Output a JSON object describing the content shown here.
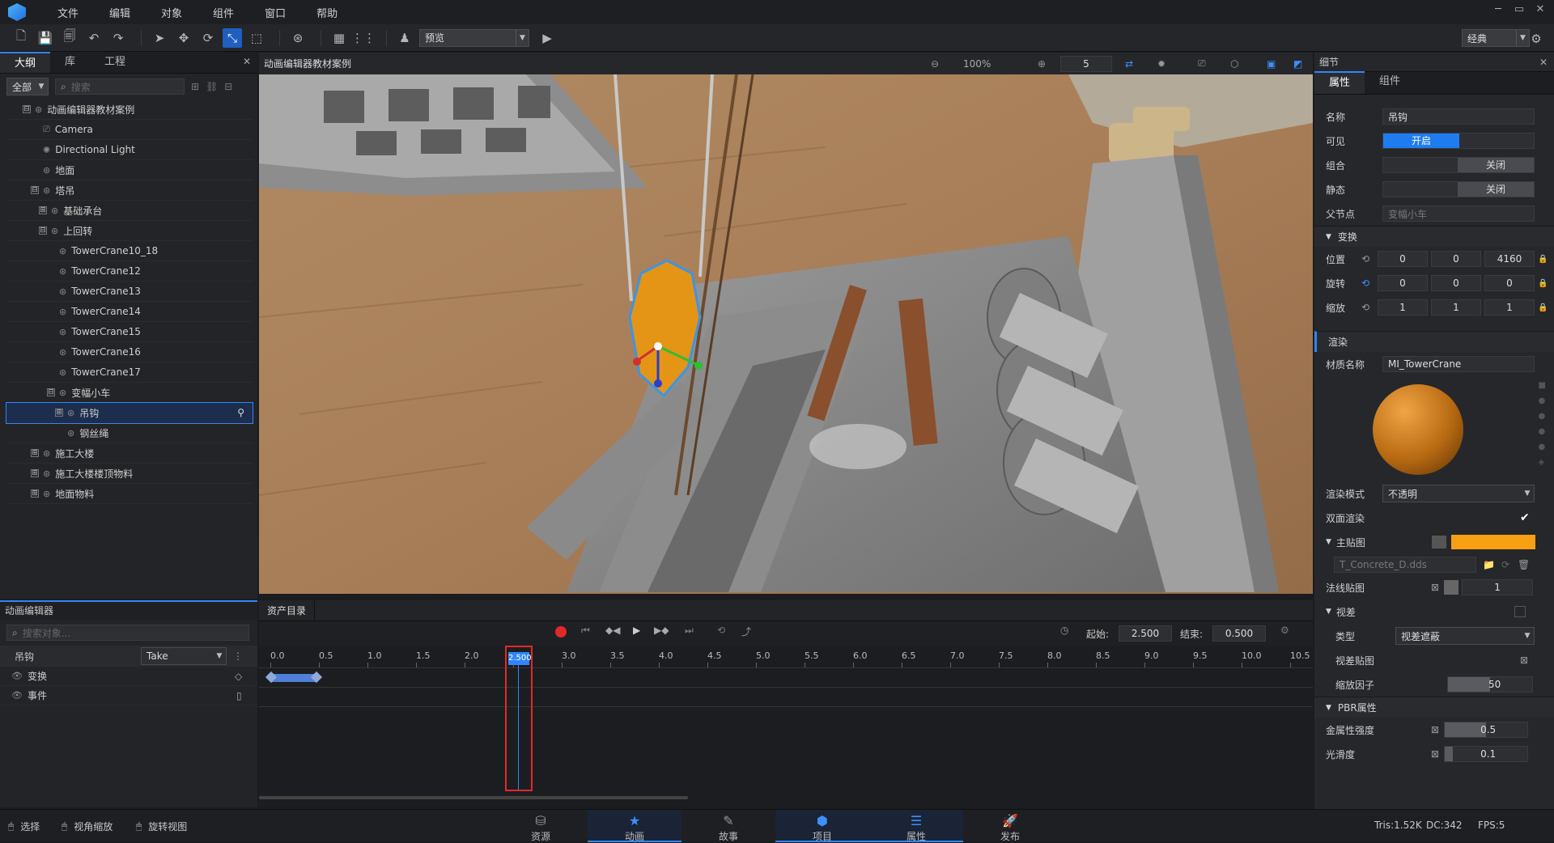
{
  "menu": [
    "文件",
    "编辑",
    "对象",
    "组件",
    "窗口",
    "帮助"
  ],
  "window_controls": [
    "─",
    "▭",
    "✕"
  ],
  "toolbar": {
    "view_mode": "预览",
    "layout": "经典"
  },
  "outline": {
    "tabs": [
      "大纲",
      "库",
      "工程"
    ],
    "filter": "全部",
    "search_placeholder": "搜索",
    "items": [
      "动画编辑器教材案例",
      "Camera",
      "Directional Light",
      "地面",
      "塔吊",
      "基础承台",
      "上回转",
      "TowerCrane10_18",
      "TowerCrane12",
      "TowerCrane13",
      "TowerCrane14",
      "TowerCrane15",
      "TowerCrane16",
      "TowerCrane17",
      "变幅小车",
      "吊钩",
      "钢丝绳",
      "施工大楼",
      "施工大楼楼顶物料",
      "地面物料"
    ]
  },
  "viewport": {
    "title": "动画编辑器教材案例",
    "zoom": "100%",
    "grid_value": "5"
  },
  "details": {
    "title": "细节",
    "tabs": [
      "属性",
      "组件"
    ],
    "name_label": "名称",
    "name": "吊钩",
    "visible_label": "可见",
    "visible": "开启",
    "group_label": "组合",
    "group": "关闭",
    "static_label": "静态",
    "static": "关闭",
    "parent_label": "父节点",
    "parent": "变幅小车",
    "transform": "变换",
    "position_label": "位置",
    "position": [
      "0",
      "0",
      "4160"
    ],
    "rotation_label": "旋转",
    "rotation": [
      "0",
      "0",
      "0"
    ],
    "scale_label": "缩放",
    "scale": [
      "1",
      "1",
      "1"
    ],
    "render": "渲染",
    "material_label": "材质名称",
    "material": "MI_TowerCrane",
    "render_mode_label": "渲染模式",
    "render_mode": "不透明",
    "double_label": "双面渲染",
    "main_tex_label": "主贴图",
    "main_tex": "T_Concrete_D.dds",
    "main_color": "#f7a014",
    "normal_label": "法线贴图",
    "normal": "1",
    "parallax": "视差",
    "type_label": "类型",
    "type": "视差遮蔽",
    "parallax_tex_label": "视差贴图",
    "scale_factor_label": "缩放因子",
    "scale_factor": "50",
    "scale_factor_frac": 0.5,
    "pbr": "PBR属性",
    "metal_label": "金属性强度",
    "metal": "0.5",
    "metal_frac": 0.5,
    "smooth_label": "光滑度",
    "smooth": "0.1",
    "smooth_frac": 0.1
  },
  "anim": {
    "title": "动画编辑器",
    "assets_tab": "资产目录",
    "search_placeholder": "搜索对象...",
    "object": "吊钩",
    "take": "Take",
    "tracks": [
      "变换",
      "事件"
    ],
    "start_label": "起始:",
    "start": "2.500",
    "end_label": "结束:",
    "end": "0.500",
    "ticks": [
      "0.0",
      "0.5",
      "1.0",
      "1.5",
      "2.0",
      "2.5",
      "3.0",
      "3.5",
      "4.0",
      "4.5",
      "5.0",
      "5.5",
      "6.0",
      "6.5",
      "7.0",
      "7.5",
      "8.0",
      "8.5",
      "9.0",
      "9.5",
      "10.0",
      "10.5"
    ],
    "playhead": "2.500",
    "playhead_value": 2.5
  },
  "bottom": {
    "modes": [
      "选择",
      "视角缩放",
      "旋转视图"
    ],
    "tabs": [
      "资源",
      "动画",
      "故事",
      "项目",
      "属性",
      "发布"
    ],
    "stats": [
      "Tris:1.52K",
      "DC:342",
      "FPS:5"
    ]
  }
}
